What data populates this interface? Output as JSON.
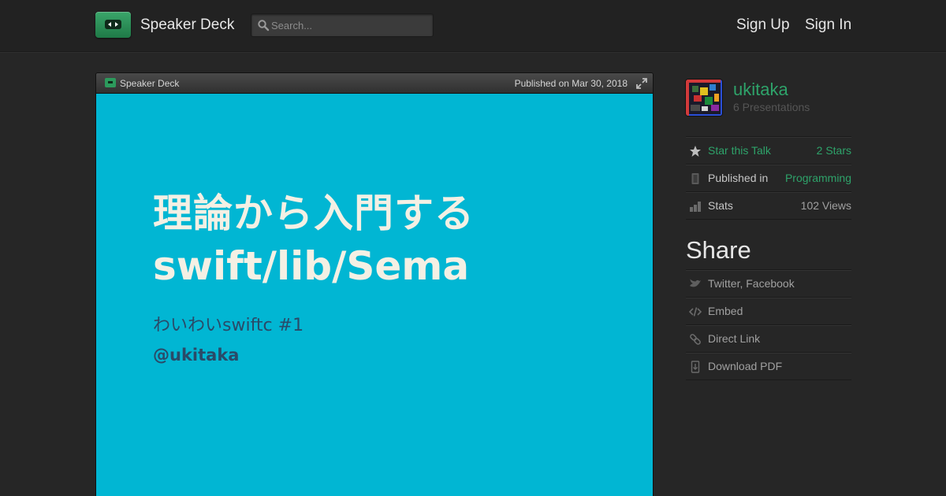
{
  "header": {
    "brand": "Speaker Deck",
    "search_placeholder": "Search...",
    "sign_up": "Sign Up",
    "sign_in": "Sign In"
  },
  "player": {
    "brand": "Speaker Deck",
    "published": "Published on Mar 30, 2018"
  },
  "slide": {
    "title_ja": "理論から入門する",
    "title_en": "swift/lib/Sema",
    "subtitle": "わいわいswiftc #1",
    "author": "@ukitaka",
    "background_color": "#01b6d3"
  },
  "profile": {
    "username": "ukitaka",
    "presentations": "6 Presentations"
  },
  "details": [
    {
      "icon": "star-icon",
      "label": "Star this Talk",
      "value": "2 Stars"
    },
    {
      "icon": "bookmark-icon",
      "label": "Published in",
      "value": "Programming"
    },
    {
      "icon": "bar-chart-icon",
      "label": "Stats",
      "value": "102 Views"
    }
  ],
  "share": {
    "title": "Share",
    "items": [
      {
        "icon": "bird-icon",
        "label": "Twitter, Facebook"
      },
      {
        "icon": "code-icon",
        "label": "Embed"
      },
      {
        "icon": "link-icon",
        "label": "Direct Link"
      },
      {
        "icon": "download-icon",
        "label": "Download PDF"
      }
    ]
  },
  "colors": {
    "accent_green": "#2ea36a",
    "background": "#262626"
  }
}
